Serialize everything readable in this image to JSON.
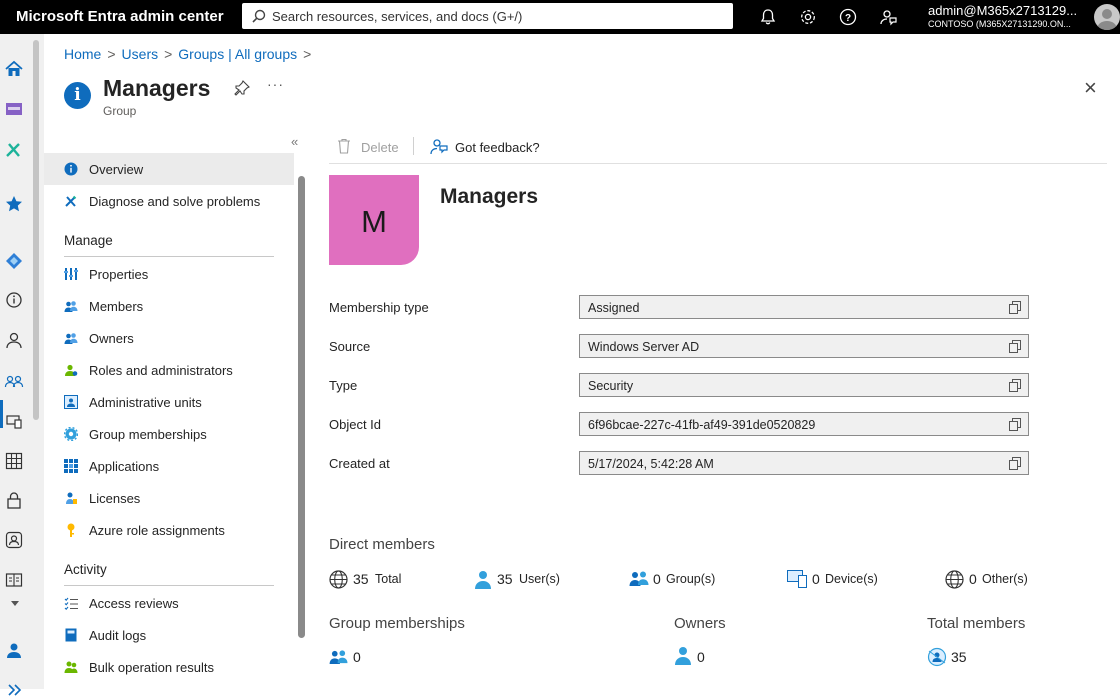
{
  "app": {
    "title": "Microsoft Entra admin center"
  },
  "search": {
    "placeholder": "Search resources, services, and docs (G+/)"
  },
  "account": {
    "user": "admin@M365x2713129...",
    "tenant": "CONTOSO (M365X27131290.ON..."
  },
  "topbar_icons": [
    "bell-icon",
    "gear-icon",
    "help-icon",
    "feedback-icon"
  ],
  "breadcrumb": [
    "Home",
    "Users",
    "Groups | All groups"
  ],
  "page": {
    "title": "Managers",
    "subtitle": "Group",
    "more": "···"
  },
  "nav": {
    "items": [
      {
        "label": "Overview",
        "icon": "info-icon"
      },
      {
        "label": "Diagnose and solve problems",
        "icon": "wrench-icon"
      }
    ],
    "manage_header": "Manage",
    "manage": [
      {
        "label": "Properties",
        "icon": "properties-icon"
      },
      {
        "label": "Members",
        "icon": "members-icon"
      },
      {
        "label": "Owners",
        "icon": "owners-icon"
      },
      {
        "label": "Roles and administrators",
        "icon": "roles-icon"
      },
      {
        "label": "Administrative units",
        "icon": "admin-units-icon"
      },
      {
        "label": "Group memberships",
        "icon": "gear-group-icon"
      },
      {
        "label": "Applications",
        "icon": "apps-grid-icon"
      },
      {
        "label": "Licenses",
        "icon": "license-icon"
      },
      {
        "label": "Azure role assignments",
        "icon": "key-icon"
      }
    ],
    "activity_header": "Activity",
    "activity": [
      {
        "label": "Access reviews",
        "icon": "checklist-icon"
      },
      {
        "label": "Audit logs",
        "icon": "book-icon"
      },
      {
        "label": "Bulk operation results",
        "icon": "bulk-icon"
      }
    ]
  },
  "commands": {
    "delete": "Delete",
    "feedback": "Got feedback?"
  },
  "group": {
    "initial": "M",
    "name": "Managers",
    "tile_color": "#e06fbf"
  },
  "properties": [
    {
      "label": "Membership type",
      "value": "Assigned"
    },
    {
      "label": "Source",
      "value": "Windows Server AD"
    },
    {
      "label": "Type",
      "value": "Security"
    },
    {
      "label": "Object Id",
      "value": "6f96bcae-227c-41fb-af49-391de0520829"
    },
    {
      "label": "Created at",
      "value": "5/17/2024, 5:42:28 AM"
    }
  ],
  "direct_members": {
    "header": "Direct members",
    "stats": [
      {
        "num": "35",
        "label": "Total",
        "icon": "globe-icon"
      },
      {
        "num": "35",
        "label": "User(s)",
        "icon": "user-icon"
      },
      {
        "num": "0",
        "label": "Group(s)",
        "icon": "group-icon"
      },
      {
        "num": "0",
        "label": "Device(s)",
        "icon": "device-icon"
      },
      {
        "num": "0",
        "label": "Other(s)",
        "icon": "globe-icon"
      }
    ]
  },
  "summary": [
    {
      "label": "Group memberships",
      "value": "0",
      "icon": "group-icon"
    },
    {
      "label": "Owners",
      "value": "0",
      "icon": "user-icon"
    },
    {
      "label": "Total members",
      "value": "35",
      "icon": "members-total-icon"
    }
  ],
  "colors": {
    "accent": "#0f6cbd",
    "topbar": "#000000",
    "rail": "#f0f0f0"
  }
}
